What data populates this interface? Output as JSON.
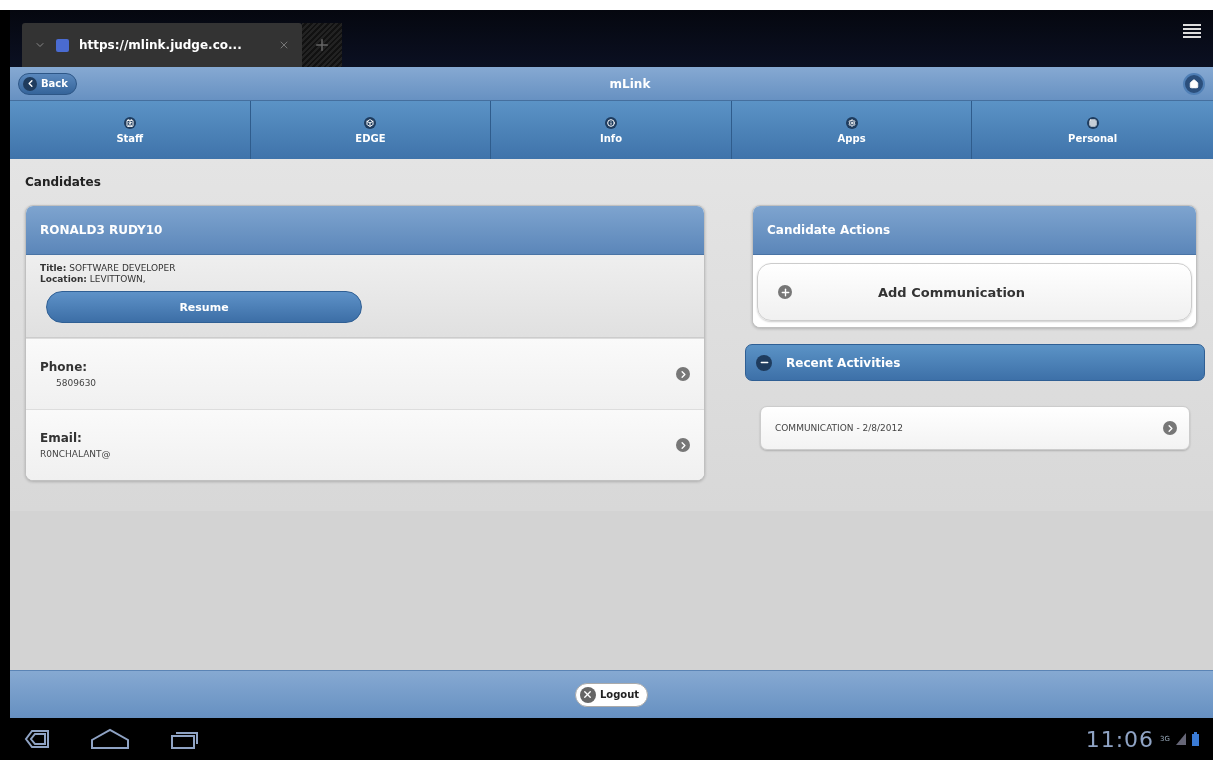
{
  "browser": {
    "tabs": [
      {
        "title": "https://mlink.judge.co...",
        "selected": true
      }
    ]
  },
  "header": {
    "back": "Back",
    "title": "mLink"
  },
  "nav": [
    {
      "label": "Staff"
    },
    {
      "label": "EDGE"
    },
    {
      "label": "Info"
    },
    {
      "label": "Apps"
    },
    {
      "label": "Personal"
    }
  ],
  "page_title": "Candidates",
  "candidate": {
    "name": "RONALD3 RUDY10",
    "fields": [
      {
        "label": "Title:",
        "value": "SOFTWARE DEVELOPER"
      },
      {
        "label": "Location:",
        "value": "LEVITTOWN,"
      }
    ],
    "resume": "Resume",
    "contacts": [
      {
        "kind": "phone",
        "label": "Phone:",
        "value": "5809630"
      },
      {
        "kind": "email",
        "label": "Email:",
        "value": "R0NCHALANT@"
      }
    ]
  },
  "actions": {
    "title": "Candidate Actions",
    "items": [
      "Add Communication"
    ]
  },
  "recent": {
    "title": "Recent Activities",
    "expanded": true,
    "items": [
      "COMMUNICATION - 2/8/2012"
    ]
  },
  "footer": {
    "logout": "Logout"
  },
  "system": {
    "time": "11:06",
    "network": "3G"
  }
}
